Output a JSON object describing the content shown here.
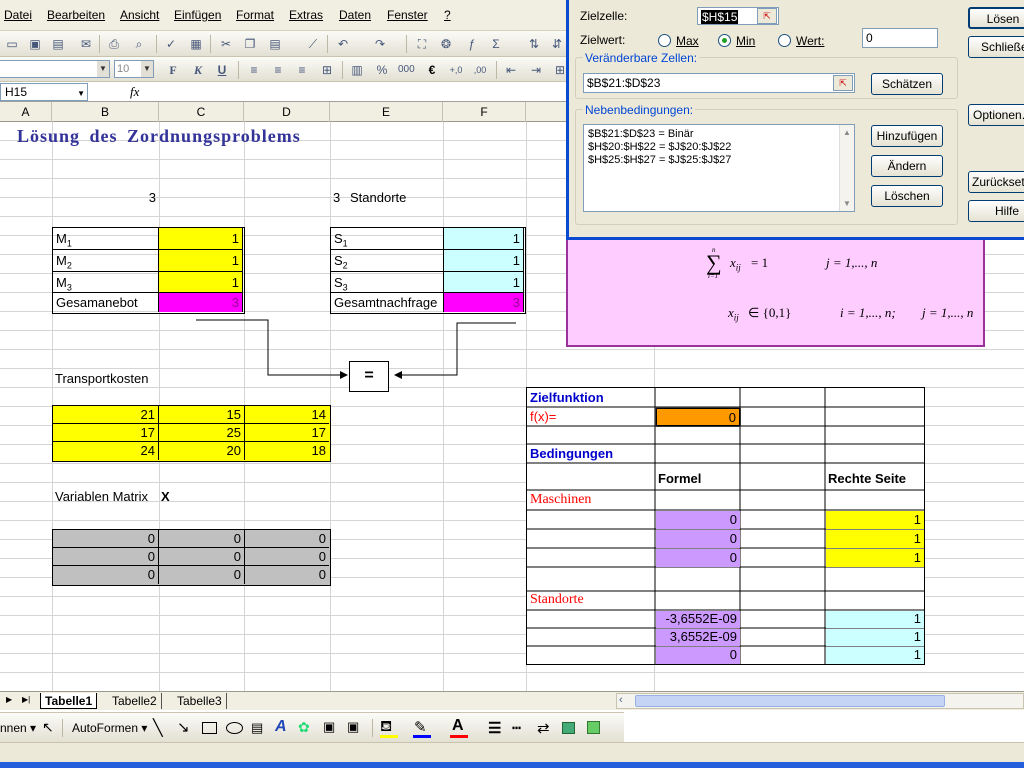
{
  "menu": [
    "Datei",
    "Bearbeiten",
    "Ansicht",
    "Einfügen",
    "Format",
    "Extras",
    "Daten",
    "Fenster",
    "?"
  ],
  "toolbar": {
    "font_size": "10"
  },
  "formula_bar": {
    "name_box": "H15",
    "fx": "fx"
  },
  "columns": [
    "A",
    "B",
    "C",
    "D",
    "E",
    "F"
  ],
  "sheet": {
    "title": "Lösung des Zordnungsproblems",
    "count_machines": "3",
    "count_locations_num": "3",
    "count_locations_label": "Standorte",
    "machines": [
      {
        "label": "M",
        "sub": "1",
        "value": "1"
      },
      {
        "label": "M",
        "sub": "2",
        "value": "1"
      },
      {
        "label": "M",
        "sub": "3",
        "value": "1"
      }
    ],
    "total_supply_label": "Gesamanebot",
    "total_supply_value": "3",
    "locations": [
      {
        "label": "S",
        "sub": "1",
        "value": "1"
      },
      {
        "label": "S",
        "sub": "2",
        "value": "1"
      },
      {
        "label": "S",
        "sub": "3",
        "value": "1"
      }
    ],
    "total_demand_label": "Gesamtnachfrage",
    "total_demand_value": "3",
    "equals": "=",
    "transport_label": "Transportkosten",
    "transport": [
      [
        "21",
        "15",
        "14"
      ],
      [
        "17",
        "25",
        "17"
      ],
      [
        "24",
        "20",
        "18"
      ]
    ],
    "var_label": "Variablen Matrix",
    "var_label_x": "X",
    "variables": [
      [
        "0",
        "0",
        "0"
      ],
      [
        "0",
        "0",
        "0"
      ],
      [
        "0",
        "0",
        "0"
      ]
    ],
    "objective_label": "Zielfunktion",
    "fx_label": "f(x)=",
    "fx_value": "0",
    "constraints_label": "Bedingungen",
    "formula_header": "Formel",
    "rhs_header": "Rechte Seite",
    "machines_label": "Maschinen",
    "machine_formula": [
      "0",
      "0",
      "0"
    ],
    "machine_rhs": [
      "1",
      "1",
      "1"
    ],
    "locations_label": "Standorte",
    "location_formula": [
      "-3,6552E-09",
      "3,6552E-09",
      "0"
    ],
    "location_rhs": [
      "1",
      "1",
      "1"
    ]
  },
  "math": {
    "sum_top": "n",
    "sum_sigma": "∑",
    "sum_bottom": "i=1",
    "eq1_lhs": "x",
    "eq1_sub": "ij",
    "eq1_rhs": "= 1",
    "eq1_range": "j = 1,..., n",
    "eq2_lhs": "x",
    "eq2_sub": "ij",
    "eq2_rhs": "∈ {0,1}",
    "eq2_range_i": "i = 1,..., n;",
    "eq2_range_j": "j = 1,..., n"
  },
  "dialog": {
    "target_cell_label": "Zielzelle:",
    "target_cell_value": "$H$15",
    "target_value_label": "Zielwert:",
    "opt_max": "Max",
    "opt_min": "Min",
    "opt_value": "Wert:",
    "value_field": "0",
    "changing_label": "Veränderbare Zellen:",
    "changing_value": "$B$21:$D$23",
    "guess_button": "Schätzen",
    "constraints_label": "Nebenbedingungen:",
    "constraints": [
      "$B$21:$D$23 = Binär",
      "$H$20:$H$22 = $J$20:$J$22",
      "$H$25:$H$27 = $J$25:$J$27"
    ],
    "add_button": "Hinzufügen",
    "change_button": "Ändern",
    "delete_button": "Löschen",
    "solve_button": "Lösen",
    "close_button": "Schließen",
    "options_button": "Optionen...",
    "reset_button": "Zurücksetzen",
    "help_button": "Hilfe"
  },
  "sheet_tabs": [
    "Tabelle1",
    "Tabelle2",
    "Tabelle3"
  ],
  "drawbar": {
    "zeichnen": "nnen",
    "autoformen": "AutoFormen"
  }
}
